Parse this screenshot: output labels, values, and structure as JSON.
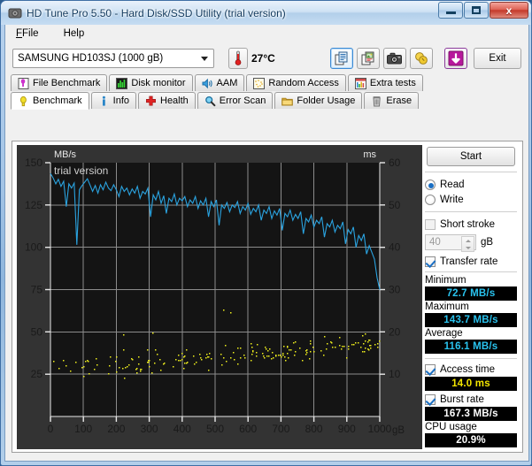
{
  "window": {
    "title": "HD Tune Pro 5.50 - Hard Disk/SSD Utility (trial version)",
    "icon": "hdtune-app-icon",
    "minimize_label": "Minimize",
    "maximize_label": "Maximize",
    "close_label": "x"
  },
  "menu": {
    "items": [
      {
        "label": "File",
        "accel": "F"
      },
      {
        "label": "Help",
        "accel": "H"
      }
    ]
  },
  "toolbar": {
    "device": "SAMSUNG HD103SJ (1000 gB)",
    "temperature": "27°C",
    "thermometer_icon": "thermometer-icon",
    "buttons": [
      {
        "name": "copy-text-button",
        "icon": "copy-text-icon",
        "selected": true
      },
      {
        "name": "copy-image-button",
        "icon": "copy-image-icon",
        "selected": false
      },
      {
        "name": "screenshot-button",
        "icon": "camera-icon",
        "selected": false
      },
      {
        "name": "options-button",
        "icon": "coins-icon",
        "selected": false
      },
      {
        "name": "save-button",
        "icon": "download-arrow-icon",
        "selected": false
      }
    ],
    "exit_label": "Exit"
  },
  "tabs": {
    "row1": [
      {
        "label": "File Benchmark",
        "icon": "file-benchmark-icon",
        "active": false
      },
      {
        "label": "Disk monitor",
        "icon": "disk-monitor-icon",
        "active": false
      },
      {
        "label": "AAM",
        "icon": "aam-speaker-icon",
        "active": false
      },
      {
        "label": "Random Access",
        "icon": "random-access-icon",
        "active": false
      },
      {
        "label": "Extra tests",
        "icon": "extra-tests-icon",
        "active": false
      }
    ],
    "row2": [
      {
        "label": "Benchmark",
        "icon": "benchmark-bulb-icon",
        "active": true
      },
      {
        "label": "Info",
        "icon": "info-icon",
        "active": false
      },
      {
        "label": "Health",
        "icon": "health-cross-icon",
        "active": false
      },
      {
        "label": "Error Scan",
        "icon": "error-scan-magnifier-icon",
        "active": false
      },
      {
        "label": "Folder Usage",
        "icon": "folder-usage-icon",
        "active": false
      },
      {
        "label": "Erase",
        "icon": "erase-trash-icon",
        "active": false
      }
    ]
  },
  "controls": {
    "start_label": "Start",
    "mode_read": "Read",
    "mode_write": "Write",
    "mode_selected": "Read",
    "short_stroke_label": "Short stroke",
    "short_stroke_checked": false,
    "short_stroke_value": "40",
    "short_stroke_unit": "gB",
    "transfer_rate_label": "Transfer rate",
    "transfer_rate_checked": true,
    "access_time_label": "Access time",
    "access_time_checked": true,
    "burst_rate_label": "Burst rate",
    "burst_rate_checked": true
  },
  "results": {
    "minimum_label": "Minimum",
    "minimum_value": "72.7 MB/s",
    "maximum_label": "Maximum",
    "maximum_value": "143.7 MB/s",
    "average_label": "Average",
    "average_value": "116.1 MB/s",
    "access_time_value": "14.0 ms",
    "burst_rate_value": "167.3 MB/s",
    "cpu_usage_label": "CPU usage",
    "cpu_usage_value": "20.9%"
  },
  "chart_data": {
    "type": "line",
    "title": "",
    "watermark": "trial version",
    "xlabel": "gB",
    "ylabel": "MB/s",
    "y2label": "ms",
    "xlim": [
      0,
      1000
    ],
    "ylim": [
      0,
      150
    ],
    "y2lim": [
      0,
      60
    ],
    "xticks": [
      0,
      100,
      200,
      300,
      400,
      500,
      600,
      700,
      800,
      900,
      1000
    ],
    "yticks": [
      25,
      50,
      75,
      100,
      125,
      150
    ],
    "y2ticks": [
      10,
      20,
      30,
      40,
      50,
      60
    ],
    "grid": true,
    "background": "#333333",
    "plot_background": "#131313",
    "series": [
      {
        "name": "Transfer rate",
        "type": "line",
        "color": "#2aa3e0",
        "axis": "left",
        "unit": "MB/s",
        "x": [
          0,
          8,
          16,
          24,
          32,
          40,
          48,
          56,
          64,
          72,
          80,
          88,
          96,
          104,
          112,
          120,
          128,
          136,
          144,
          152,
          160,
          168,
          176,
          184,
          192,
          200,
          208,
          216,
          224,
          232,
          240,
          248,
          256,
          264,
          272,
          280,
          288,
          296,
          304,
          312,
          320,
          328,
          336,
          344,
          352,
          360,
          368,
          376,
          384,
          392,
          400,
          408,
          416,
          424,
          432,
          440,
          448,
          456,
          464,
          472,
          480,
          488,
          496,
          504,
          512,
          520,
          528,
          536,
          544,
          552,
          560,
          568,
          576,
          584,
          592,
          600,
          608,
          616,
          624,
          632,
          640,
          648,
          656,
          664,
          672,
          680,
          688,
          696,
          704,
          712,
          720,
          728,
          736,
          744,
          752,
          760,
          768,
          776,
          784,
          792,
          800,
          808,
          816,
          824,
          832,
          840,
          848,
          856,
          864,
          872,
          880,
          888,
          896,
          904,
          912,
          920,
          928,
          936,
          944,
          952,
          960,
          968,
          976,
          984,
          992,
          1000
        ],
        "y": [
          143.7,
          141.0,
          137.5,
          140.2,
          136.0,
          139.0,
          124.0,
          137.5,
          135.0,
          138.0,
          101.5,
          134.0,
          136.5,
          138.5,
          140.5,
          137.0,
          133.0,
          136.5,
          132.0,
          137.0,
          134.0,
          138.5,
          135.0,
          133.5,
          137.0,
          134.0,
          130.0,
          136.0,
          133.0,
          135.0,
          131.0,
          134.5,
          132.0,
          136.0,
          129.0,
          133.0,
          131.5,
          135.0,
          118.0,
          131.0,
          128.0,
          133.0,
          126.0,
          130.5,
          120.0,
          129.0,
          127.0,
          131.5,
          125.0,
          129.0,
          127.5,
          130.0,
          124.0,
          128.0,
          126.0,
          130.0,
          123.0,
          127.5,
          125.0,
          129.0,
          118.0,
          127.0,
          124.0,
          128.0,
          113.0,
          125.0,
          123.0,
          126.5,
          121.0,
          125.0,
          123.5,
          127.0,
          120.0,
          124.0,
          122.0,
          126.0,
          119.5,
          123.0,
          121.0,
          125.0,
          116.0,
          122.0,
          120.0,
          124.0,
          117.0,
          121.5,
          119.0,
          123.0,
          110.0,
          120.0,
          118.0,
          122.0,
          116.0,
          119.5,
          117.0,
          121.0,
          108.0,
          117.0,
          115.0,
          119.0,
          112.0,
          116.0,
          114.0,
          118.0,
          106.0,
          114.0,
          112.0,
          116.0,
          109.0,
          113.0,
          111.0,
          115.0,
          102.0,
          110.5,
          108.0,
          112.0,
          100.0,
          107.0,
          104.0,
          108.0,
          96.0,
          101.0,
          97.0,
          93.0,
          82.0,
          75.0
        ]
      },
      {
        "name": "Access time",
        "type": "scatter",
        "color": "#eded1c",
        "axis": "right",
        "unit": "ms",
        "mean": 14.0,
        "note": "scatter cloud of ~700 samples, rising from ~8-14 ms near 0 gB to ~16-22 ms near 1000 gB, with occasional outliers up to ~26 ms"
      }
    ]
  }
}
